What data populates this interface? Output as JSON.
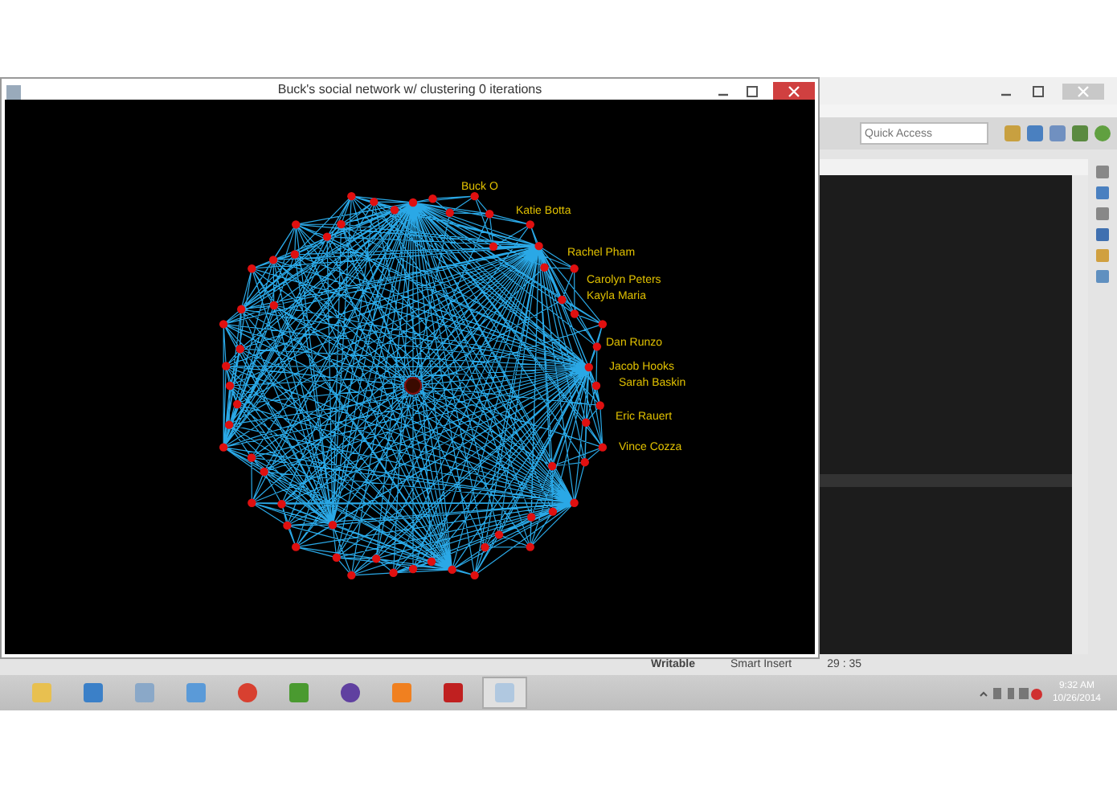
{
  "graph_window": {
    "title": "Buck's social network w/ clustering 0 iterations",
    "node_labels": [
      "Buck O",
      "Katie Botta",
      "Rachel Pham",
      "Carolyn Peters",
      "Kayla Maria",
      "Dan Runzo",
      "Jacob Hooks",
      "Sarah Baskin",
      "Eric Rauert",
      "Vince Cozza"
    ]
  },
  "ide": {
    "quick_access": {
      "placeholder": "Quick Access"
    },
    "status_bar": [
      "Writable",
      "Smart Insert",
      "29 : 35"
    ]
  },
  "taskbar": {
    "clock": {
      "time": "9:32 AM",
      "date": "10/26/2014"
    }
  }
}
